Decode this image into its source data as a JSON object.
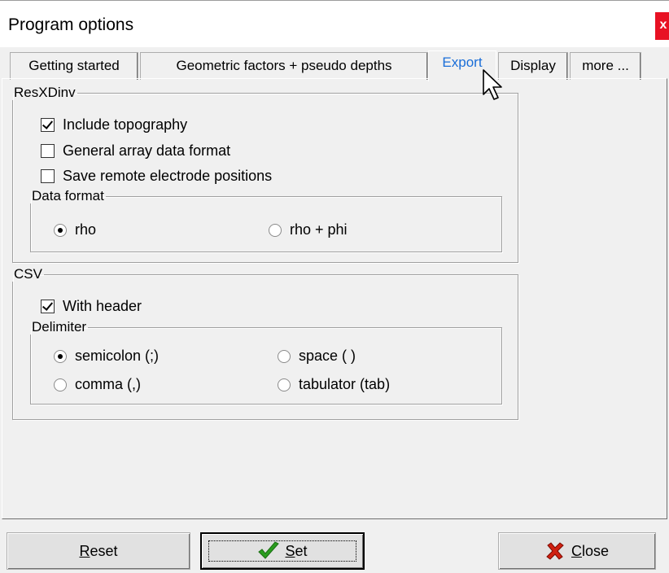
{
  "window": {
    "title": "Program options",
    "close_glyph": "x"
  },
  "tabs": [
    {
      "label": "Getting started"
    },
    {
      "label": "Geometric factors + pseudo depths"
    },
    {
      "label": "Export"
    },
    {
      "label": "Display"
    },
    {
      "label": "more ..."
    }
  ],
  "active_tab": "Export",
  "resxdinv": {
    "legend": "ResXDinv",
    "include_topography": {
      "label": "Include topography",
      "checked": true
    },
    "general_array": {
      "label": "General array data format",
      "checked": false
    },
    "save_remote": {
      "label": "Save remote electrode positions",
      "checked": false
    },
    "data_format": {
      "legend": "Data format",
      "options": [
        {
          "label": "rho",
          "selected": true
        },
        {
          "label": "rho + phi",
          "selected": false
        }
      ]
    }
  },
  "csv": {
    "legend": "CSV",
    "with_header": {
      "label": "With header",
      "checked": true
    },
    "delimiter": {
      "legend": "Delimiter",
      "options": [
        {
          "label": "semicolon (;)",
          "selected": true
        },
        {
          "label": "space ( )",
          "selected": false
        },
        {
          "label": "comma (,)",
          "selected": false
        },
        {
          "label": "tabulator (tab)",
          "selected": false
        }
      ]
    }
  },
  "buttons": {
    "reset": {
      "mnemonic": "R",
      "rest": "eset"
    },
    "set": {
      "mnemonic": "S",
      "rest": "et",
      "icon": "green-checkmark-icon"
    },
    "close": {
      "mnemonic": "C",
      "rest": "lose",
      "icon": "red-x-icon"
    }
  },
  "colors": {
    "active_tab_text": "#1a6ed8",
    "close_button_bg": "#e81123",
    "check_icon": "#2a9d1f",
    "x_icon": "#d02010"
  }
}
